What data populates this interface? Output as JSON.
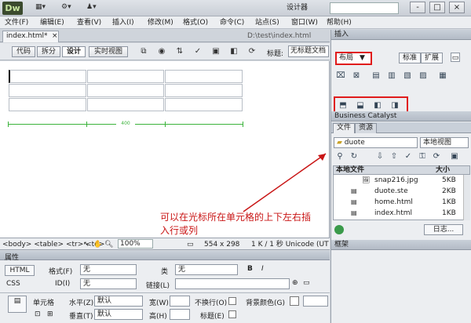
{
  "app": {
    "logo": "Dw",
    "workspace": "设计器",
    "window_buttons": [
      "-",
      "□",
      "×"
    ]
  },
  "menu": [
    "文件(F)",
    "编辑(E)",
    "查看(V)",
    "插入(I)",
    "修改(M)",
    "格式(O)",
    "命令(C)",
    "站点(S)",
    "窗口(W)",
    "帮助(H)"
  ],
  "document": {
    "tab_label": "index.html*",
    "path": "D:\\test\\index.html",
    "views": [
      "代码",
      "拆分",
      "设计",
      "实时视图"
    ],
    "active_view": "设计",
    "title_label": "标题:",
    "title_value": "无标题文档",
    "table_width_label": "400",
    "annotation": "可以在光标所在单元格的上下左右插入行或列"
  },
  "statusbar": {
    "tag_selector": "<body> <table> <tr> <td>",
    "zoom": "100%",
    "dimensions": "554 x 298",
    "size_info": "1 K / 1 秒  Unicode (UT"
  },
  "properties": {
    "title": "属性",
    "html_btn": "HTML",
    "css_btn": "CSS",
    "format_label": "格式(F)",
    "format_value": "无",
    "class_label": "类",
    "class_value": "无",
    "id_label": "ID(I)",
    "id_value": "无",
    "link_label": "链接(L)",
    "cell_label": "单元格",
    "horz_label": "水平(Z)",
    "horz_value": "默认",
    "vert_label": "垂直(T)",
    "vert_value": "默认",
    "width_label": "宽(W)",
    "height_label": "高(H)",
    "nowrap_label": "不换行(O)",
    "header_label": "标题(E)",
    "bgcolor_label": "背景颜色(G)",
    "bold": "B",
    "italic": "I"
  },
  "insert_panel": {
    "title": "插入",
    "category": "布局",
    "tab_standard": "标准",
    "tab_extended": "扩展"
  },
  "business_catalyst": {
    "title": "Business Catalyst"
  },
  "files_panel": {
    "tabs": [
      "文件",
      "资源"
    ],
    "site": "duote",
    "view": "本地视图",
    "col_name": "本地文件",
    "col_size": "大小",
    "files": [
      {
        "name": "snap216.jpg",
        "size": "5KB"
      },
      {
        "name": "duote.ste",
        "size": "2KB"
      },
      {
        "name": "home.html",
        "size": "1KB"
      },
      {
        "name": "index.html",
        "size": "1KB"
      }
    ],
    "log_button": "日志..."
  },
  "frames_panel": {
    "title": "框架"
  },
  "colors": {
    "highlight": "#e01b1b",
    "annotation": "#c91616",
    "table_width": "#3bb33b"
  }
}
